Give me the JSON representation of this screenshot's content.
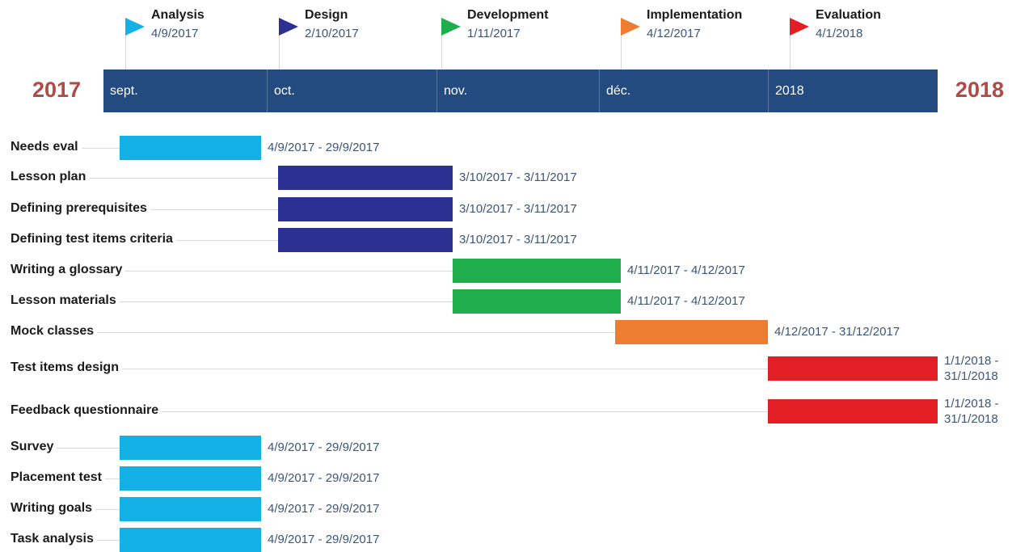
{
  "chart_data": {
    "type": "gantt",
    "years": {
      "left": "2017",
      "right": "2018"
    },
    "axis": {
      "start": "2017-09-01",
      "end": "2018-02-01",
      "months": [
        {
          "label": "sept.",
          "date": "2017-09-01"
        },
        {
          "label": "oct.",
          "date": "2017-10-01"
        },
        {
          "label": "nov.",
          "date": "2017-11-01"
        },
        {
          "label": "déc.",
          "date": "2017-12-01"
        },
        {
          "label": "2018",
          "date": "2018-01-01"
        }
      ]
    },
    "colors": {
      "analysis": "#14b1e7",
      "design": "#2b3092",
      "development": "#1fae4b",
      "implementation": "#ed7d31",
      "evaluation": "#e31e24",
      "band": "#234b7f",
      "year": "#b04a45"
    },
    "milestones": [
      {
        "name": "Analysis",
        "date_label": "4/9/2017",
        "date": "2017-09-04",
        "phase": "analysis"
      },
      {
        "name": "Design",
        "date_label": "2/10/2017",
        "date": "2017-10-02",
        "phase": "design"
      },
      {
        "name": "Development",
        "date_label": "1/11/2017",
        "date": "2017-11-01",
        "phase": "development"
      },
      {
        "name": "Implementation",
        "date_label": "4/12/2017",
        "date": "2017-12-04",
        "phase": "implementation"
      },
      {
        "name": "Evaluation",
        "date_label": "4/1/2018",
        "date": "2018-01-04",
        "phase": "evaluation"
      }
    ],
    "tasks": [
      {
        "name": "Needs  eval",
        "start": "2017-09-04",
        "end": "2017-09-29",
        "range_label": "4/9/2017 - 29/9/2017",
        "phase": "analysis"
      },
      {
        "name": "Lesson plan",
        "start": "2017-10-03",
        "end": "2017-11-03",
        "range_label": "3/10/2017 - 3/11/2017",
        "phase": "design"
      },
      {
        "name": "Defining prerequisites",
        "start": "2017-10-03",
        "end": "2017-11-03",
        "range_label": "3/10/2017 - 3/11/2017",
        "phase": "design"
      },
      {
        "name": "Defining test items criteria",
        "start": "2017-10-03",
        "end": "2017-11-03",
        "range_label": "3/10/2017 - 3/11/2017",
        "phase": "design"
      },
      {
        "name": "Writing a glossary",
        "start": "2017-11-04",
        "end": "2017-12-04",
        "range_label": "4/11/2017 - 4/12/2017",
        "phase": "development"
      },
      {
        "name": "Lesson materials",
        "start": "2017-11-04",
        "end": "2017-12-04",
        "range_label": "4/11/2017 - 4/12/2017",
        "phase": "development"
      },
      {
        "name": "Mock classes",
        "start": "2017-12-04",
        "end": "2017-12-31",
        "range_label": "4/12/2017 - 31/12/2017",
        "phase": "implementation"
      },
      {
        "name": "Test items design",
        "start": "2018-01-01",
        "end": "2018-01-31",
        "range_label": [
          "1/1/2018 -",
          "31/1/2018"
        ],
        "phase": "evaluation"
      },
      {
        "name": "Feedback questionnaire",
        "start": "2018-01-01",
        "end": "2018-01-31",
        "range_label": [
          "1/1/2018 -",
          "31/1/2018"
        ],
        "phase": "evaluation"
      },
      {
        "name": "Survey",
        "start": "2017-09-04",
        "end": "2017-09-29",
        "range_label": "4/9/2017 - 29/9/2017",
        "phase": "analysis"
      },
      {
        "name": "Placement test",
        "start": "2017-09-04",
        "end": "2017-09-29",
        "range_label": "4/9/2017 - 29/9/2017",
        "phase": "analysis"
      },
      {
        "name": "Writing goals",
        "start": "2017-09-04",
        "end": "2017-09-29",
        "range_label": "4/9/2017 - 29/9/2017",
        "phase": "analysis"
      },
      {
        "name": "Task analysis",
        "start": "2017-09-04",
        "end": "2017-09-29",
        "range_label": "4/9/2017 - 29/9/2017",
        "phase": "analysis"
      }
    ]
  }
}
